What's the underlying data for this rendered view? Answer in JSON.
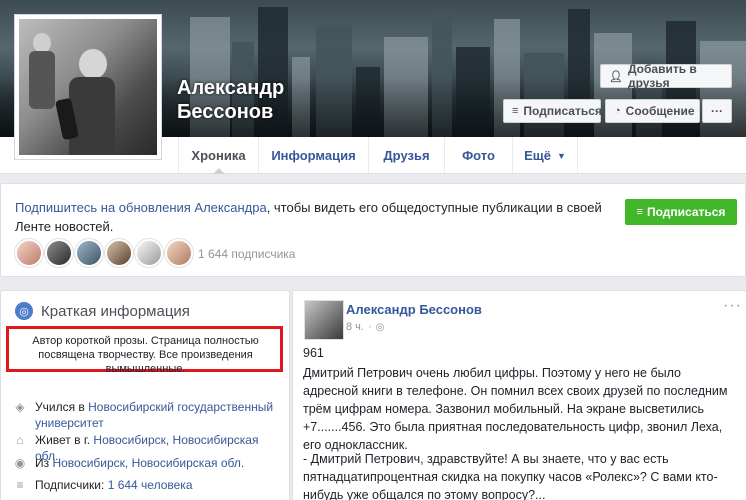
{
  "profile": {
    "name_line1": "Александр",
    "name_line2": "Бессонов"
  },
  "cover_buttons": {
    "add_friend": "Добавить в друзья",
    "subscribe": "Подписаться",
    "message": "Сообщение",
    "more": "···"
  },
  "nav": {
    "tabs": [
      {
        "label": "Хроника",
        "active": true
      },
      {
        "label": "Информация"
      },
      {
        "label": "Друзья"
      },
      {
        "label": "Фото"
      },
      {
        "label": "Ещё"
      }
    ]
  },
  "follow_card": {
    "text_link": "Подпишитесь на обновления Александра",
    "text_rest": ", чтобы видеть его общедоступные публикации в своей Ленте новостей.",
    "button_label": "Подписаться",
    "subscriber_count": "1 644 подписчика"
  },
  "intro": {
    "title": "Краткая информация",
    "bio": "Автор короткой прозы. Страница полностью посвящена творчеству. Все произведения вымышленные.",
    "studied_prefix": "Учился в ",
    "studied_link": "Новосибирский государственный университет",
    "lives_prefix": "Живет в г. ",
    "lives_link": "Новосибирск, Новосибирская обл.",
    "from_prefix": "Из ",
    "from_link": "Новосибирск, Новосибирская обл.",
    "followers_prefix": "Подписчики: ",
    "followers_link": "1 644 человека"
  },
  "post": {
    "author": "Александр Бессонов",
    "time": "8 ч.",
    "more": "···",
    "number": "961",
    "paragraph1": "Дмитрий Петрович очень любил цифры. Поэтому у него не было адресной книги в телефоне. Он помнил всех своих друзей по последним трём цифрам номера. Зазвонил мобильный. На экране высветились +7.......456. Это была приятная последовательность цифр, звонил Леха, его одноклассник.",
    "paragraph2": "- Дмитрий Петрович, здравствуйте! А вы знаете, что у вас есть пятнадцатипроцентная скидка на покупку часов «Ролекс»? С вами кто-нибудь уже общался по этому вопросу?..."
  },
  "colors": {
    "link": "#365899",
    "green": "#42b72a",
    "highlight_border": "#e0171e",
    "page_bg": "#e9ebee"
  }
}
